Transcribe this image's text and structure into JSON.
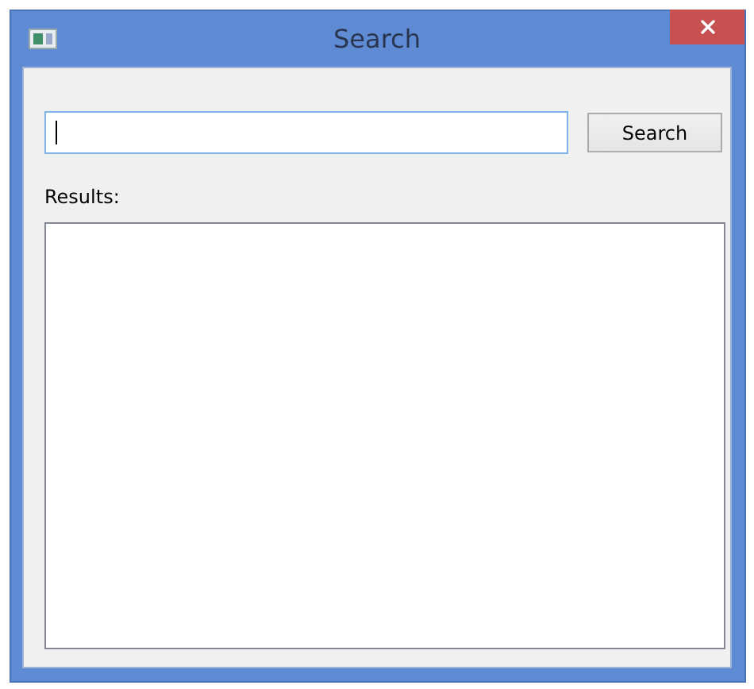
{
  "window": {
    "title": "Search"
  },
  "search": {
    "focused": true
  },
  "button": {
    "label": "Search"
  },
  "results": {
    "label": "Results:"
  }
}
